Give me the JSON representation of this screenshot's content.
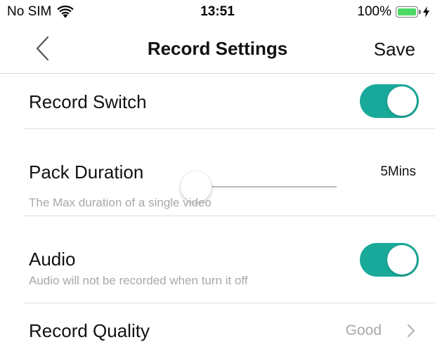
{
  "status_bar": {
    "carrier": "No SIM",
    "time": "13:51",
    "battery_percent": "100%",
    "battery_level": 1.0,
    "icons": [
      "wifi-icon",
      "battery-icon",
      "charging-bolt-icon"
    ]
  },
  "nav": {
    "title": "Record Settings",
    "save_label": "Save",
    "back_icon": "chevron-left-icon"
  },
  "settings": {
    "record_switch": {
      "label": "Record Switch",
      "on": true
    },
    "pack_duration": {
      "label": "Pack Duration",
      "description": "The Max duration of a single video",
      "value": "5Mins",
      "slider_position": 0.0
    },
    "audio": {
      "label": "Audio",
      "description": "Audio will not be recorded when turn it off",
      "on": true
    },
    "record_quality": {
      "label": "Record Quality",
      "value": "Good",
      "icon": "chevron-right-icon"
    }
  },
  "colors": {
    "toggle_on": "#19a99a",
    "battery_fill": "#4cd964",
    "secondary_text": "#a8a8a8",
    "divider": "#dcdcdc"
  }
}
